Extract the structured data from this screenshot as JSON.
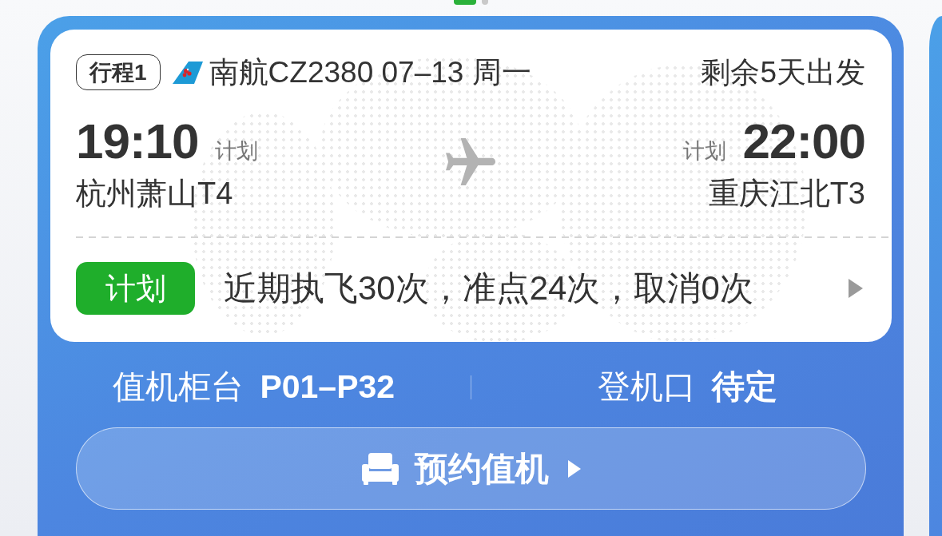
{
  "pager": [
    {
      "selected": true
    },
    {
      "selected": false
    }
  ],
  "trip": {
    "badge": "行程1",
    "flight": "南航CZ2380 07–13 周一",
    "countdown": "剩余5天出发",
    "departure": {
      "time": "19:10",
      "time_label": "计划",
      "airport": "杭州萧山T4"
    },
    "arrival": {
      "time": "22:00",
      "time_label": "计划",
      "airport": "重庆江北T3"
    },
    "status": {
      "label": "计划",
      "summary": "近期执飞30次，准点24次，取消0次"
    }
  },
  "counters": [
    {
      "label": "值机柜台",
      "value": "P01–P32"
    },
    {
      "label": "登机口",
      "value": "待定"
    }
  ],
  "checkin_button": {
    "label": "预约值机"
  }
}
